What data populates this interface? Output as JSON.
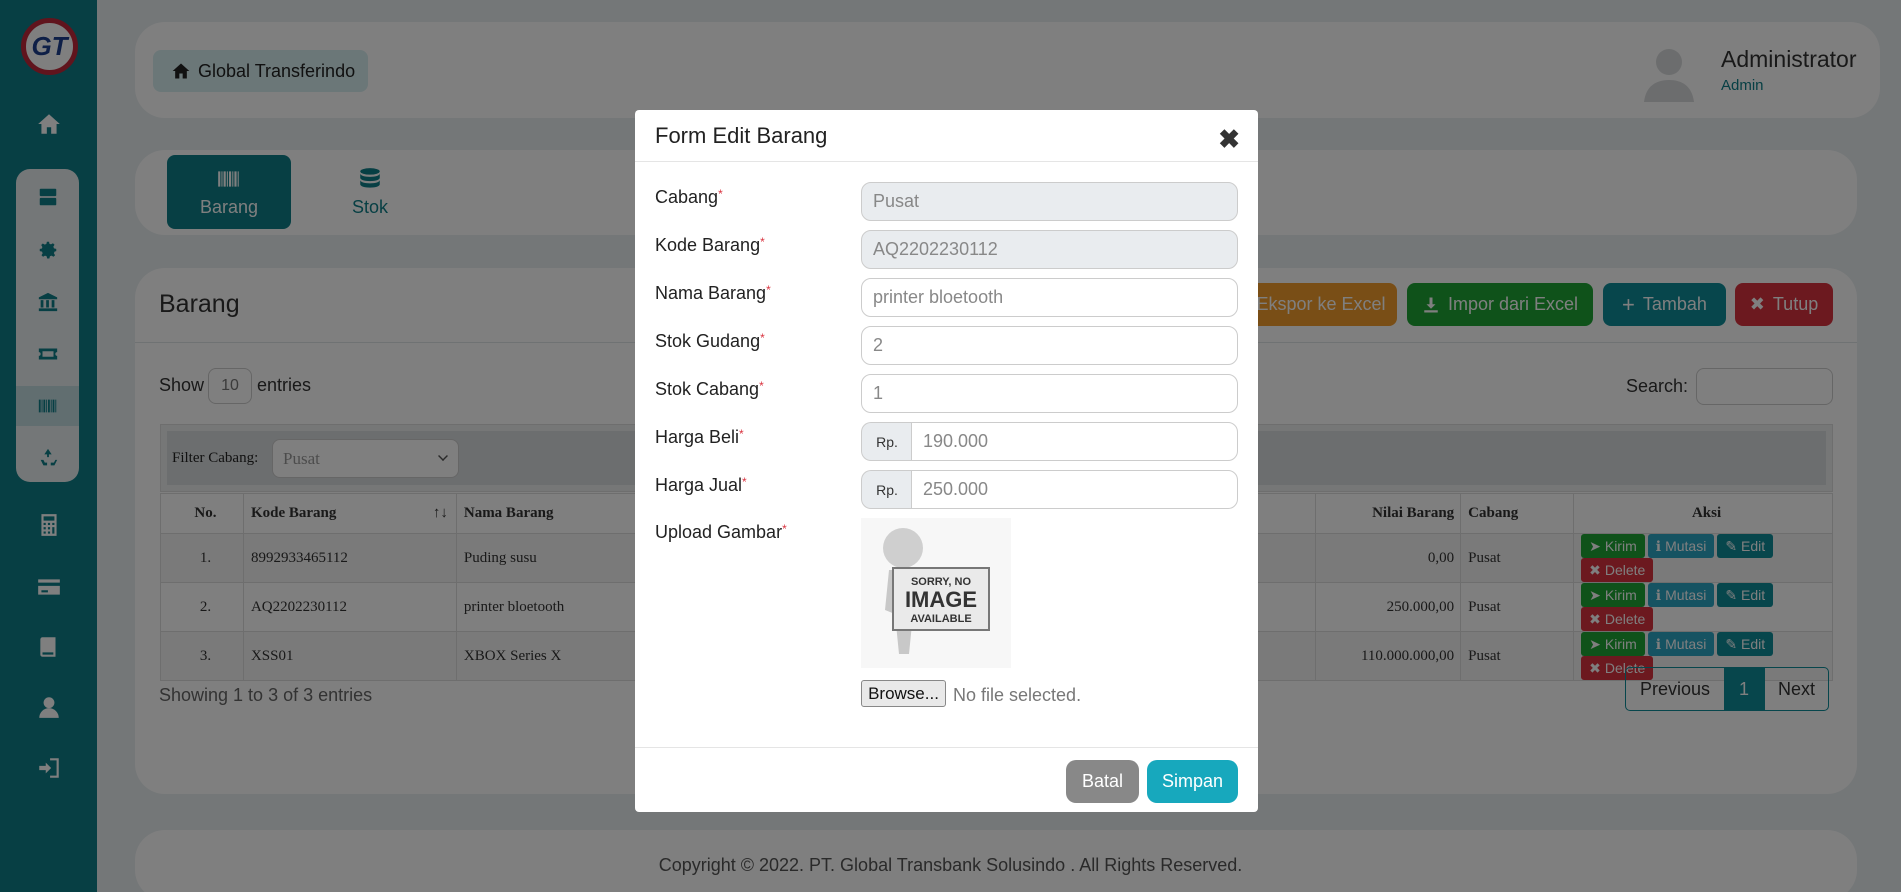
{
  "sidebar": {
    "logo_text": "GT",
    "accent": "#0e7f88"
  },
  "header": {
    "brand_label": "Global Transferindo",
    "user_name": "Administrator",
    "user_role": "Admin"
  },
  "tabs": [
    {
      "label": "Barang",
      "active": true
    },
    {
      "label": "Stok",
      "active": false
    }
  ],
  "main": {
    "title": "Barang",
    "buttons": {
      "ekspor": "Ekspor ke Excel",
      "impor": "Impor dari Excel",
      "tambah": "Tambah",
      "tutup": "Tutup"
    },
    "show_prefix": "Show",
    "entries_count": "10",
    "show_suffix": "entries",
    "search_label": "Search:",
    "filter_label": "Filter Cabang:",
    "filter_value": "Pusat",
    "columns": {
      "no": "No.",
      "kode": "Kode Barang",
      "sort_icon": "↑↓",
      "nama": "Nama Barang",
      "nilai": "Nilai Barang",
      "cabang": "Cabang",
      "aksi": "Aksi"
    },
    "rows": [
      {
        "no": "1.",
        "kode": "8992933465112",
        "nama": "Puding susu",
        "nilai": "0,00",
        "cabang": "Pusat"
      },
      {
        "no": "2.",
        "kode": "AQ2202230112",
        "nama": "printer bloetooth",
        "nilai": "250.000,00",
        "cabang": "Pusat"
      },
      {
        "no": "3.",
        "kode": "XSS01",
        "nama": "XBOX Series X",
        "nilai": "110.000.000,00",
        "cabang": "Pusat"
      }
    ],
    "row_actions": {
      "kirim": "Kirim",
      "mutasi": "Mutasi",
      "edit": "Edit",
      "delete": "Delete"
    },
    "showing": "Showing 1 to 3 of 3 entries",
    "pager": {
      "previous": "Previous",
      "current": "1",
      "next": "Next"
    }
  },
  "footer": {
    "copyright": "Copyright © 2022. PT. Global Transbank Solusindo . All Rights Reserved."
  },
  "modal": {
    "title": "Form Edit Barang",
    "close_glyph": "✖",
    "required_mark": "*",
    "fields": {
      "cabang": {
        "label": "Cabang",
        "value": "Pusat"
      },
      "kode": {
        "label": "Kode Barang",
        "value": "AQ2202230112"
      },
      "nama": {
        "label": "Nama Barang",
        "value": "printer bloetooth"
      },
      "stok_gudang": {
        "label": "Stok Gudang",
        "value": "2"
      },
      "stok_cabang": {
        "label": "Stok Cabang",
        "value": "1"
      },
      "harga_beli": {
        "label": "Harga Beli",
        "prefix": "Rp.",
        "value": "190.000"
      },
      "harga_jual": {
        "label": "Harga Jual",
        "prefix": "Rp.",
        "value": "250.000"
      },
      "gambar": {
        "label": "Upload Gambar"
      }
    },
    "placeholder_image": {
      "line1": "SORRY, NO",
      "line2": "IMAGE",
      "line3": "AVAILABLE"
    },
    "browse_label": "Browse...",
    "no_file": "No file selected.",
    "batal": "Batal",
    "simpan": "Simpan"
  }
}
